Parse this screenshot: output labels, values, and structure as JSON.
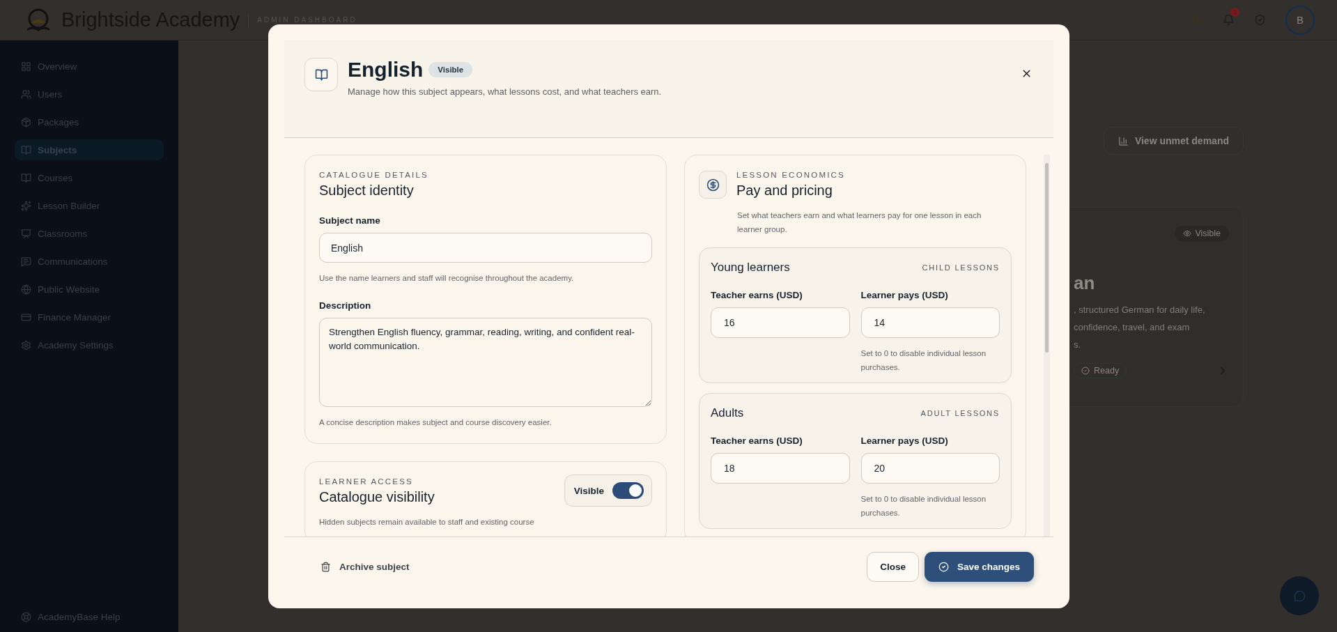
{
  "app": {
    "brand": "Brightside Academy",
    "section": "ADMIN DASHBOARD",
    "notification_count": "3",
    "avatar": "B"
  },
  "sidebar": {
    "items": [
      {
        "label": "Overview",
        "selected": false
      },
      {
        "label": "Users",
        "selected": false
      },
      {
        "label": "Packages",
        "selected": false
      },
      {
        "label": "Subjects",
        "selected": true
      },
      {
        "label": "Courses",
        "selected": false
      },
      {
        "label": "Lesson Builder",
        "selected": false
      },
      {
        "label": "Classrooms",
        "selected": false
      },
      {
        "label": "Communications",
        "selected": false
      },
      {
        "label": "Public Website",
        "selected": false
      },
      {
        "label": "Finance Manager",
        "selected": false
      },
      {
        "label": "Academy Settings",
        "selected": false
      }
    ],
    "help": "AcademyBase Help"
  },
  "background": {
    "button": "View unmet demand",
    "card": {
      "badge": "Visible",
      "title": "an",
      "description": [
        ", structured German for daily life,",
        "confidence, travel, and exam",
        "s."
      ],
      "status": "Ready"
    }
  },
  "dialog": {
    "title": "English",
    "badge": "Visible",
    "subtitle": "Manage how this subject appears, what lessons cost, and what teachers earn.",
    "identity": {
      "eyebrow": "CATALOGUE DETAILS",
      "title": "Subject identity",
      "fields": [
        {
          "kind": "input",
          "label": "Subject name",
          "value": "English",
          "hint": "Use the name learners and staff will recognise throughout the academy."
        },
        {
          "kind": "textarea",
          "label": "Description",
          "value": "Strengthen English fluency, grammar, reading, writing, and confident real-world communication.",
          "hint": "A concise description makes subject and course discovery easier."
        }
      ]
    },
    "visibility": {
      "eyebrow": "LEARNER ACCESS",
      "title": "Catalogue visibility",
      "toggle": {
        "label": "Visible",
        "on": true
      },
      "hint": "Hidden subjects remain available to staff and existing course"
    },
    "pricing": {
      "eyebrow": "LESSON ECONOMICS",
      "title": "Pay and pricing",
      "description": "Set what teachers earn and what learners pay for one lesson in each learner group.",
      "groups": [
        {
          "title": "Young learners",
          "tag": "CHILD LESSONS",
          "fields": [
            {
              "label": "Teacher earns (USD)",
              "value": "16"
            },
            {
              "label": "Learner pays (USD)",
              "value": "14",
              "hint": "Set to 0 to disable individual lesson purchases."
            }
          ]
        },
        {
          "title": "Adults",
          "tag": "ADULT LESSONS",
          "fields": [
            {
              "label": "Teacher earns (USD)",
              "value": "18"
            },
            {
              "label": "Learner pays (USD)",
              "value": "20",
              "hint": "Set to 0 to disable individual lesson purchases."
            }
          ]
        }
      ]
    },
    "footer": {
      "archive": "Archive subject",
      "close": "Close",
      "save": "Save changes"
    }
  }
}
